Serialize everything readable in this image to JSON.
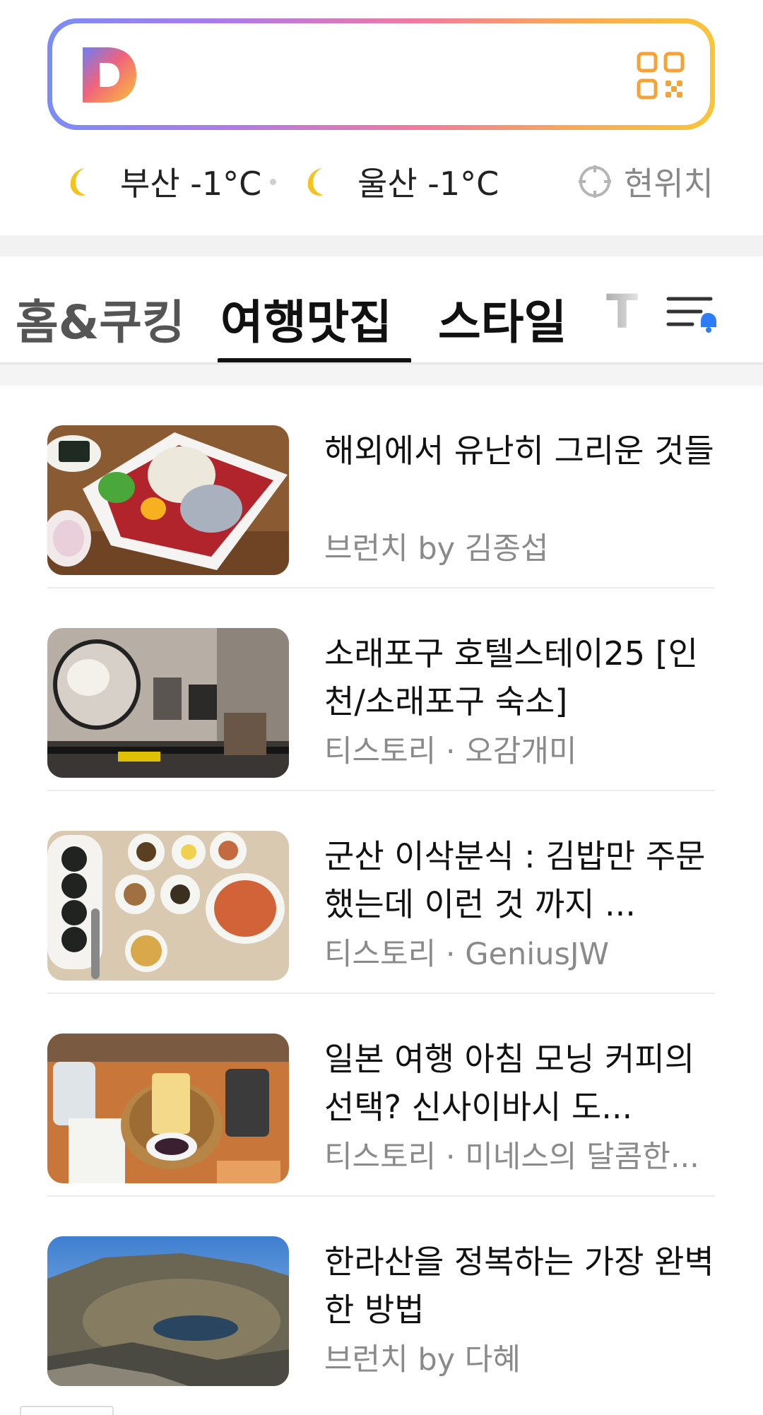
{
  "search": {
    "logo_icon": "daum-d-logo",
    "qr_icon": "qr-code-icon",
    "gradient": [
      "#7b8cf6",
      "#b07ae8",
      "#f07aa0",
      "#f7a85a",
      "#f9c53a"
    ]
  },
  "weather": {
    "items": [
      {
        "icon": "moon-icon",
        "text": "부산 -1°C"
      },
      {
        "icon": "moon-icon",
        "text": "울산 -1°C"
      }
    ],
    "location_label": "현위치"
  },
  "tabs": {
    "items": [
      "홈&쿠킹",
      "여행맛집",
      "스타일",
      "T"
    ],
    "active_index": 1,
    "menu_icon": "menu-with-notification-icon"
  },
  "feed": {
    "items": [
      {
        "title": "해외에서 유난히 그리운 것들",
        "source": "브런치 by 김종섭",
        "image": "raw-beef-yukhoe-dish"
      },
      {
        "title": "소래포구 호텔스테이25 [인천/소래포구 숙소]",
        "source": "티스토리 · 오감개미",
        "image": "hotel-room-mirror-desk"
      },
      {
        "title": "군산 이삭분식 : 김밥만 주문했는데 이런 것 까지 ...",
        "source": "티스토리 · GeniusJW",
        "image": "gimbap-side-dishes"
      },
      {
        "title": "일본 여행 아침 모닝 커피의 선택? 신사이바시 도...",
        "source": "티스토리 · 미네스의 달콤한...",
        "image": "toast-coffee-breakfast"
      },
      {
        "title": "한라산을 정복하는 가장 완벽한 방법",
        "source": "브런치 by 다혜",
        "image": "hallasan-crater-lake"
      }
    ]
  }
}
